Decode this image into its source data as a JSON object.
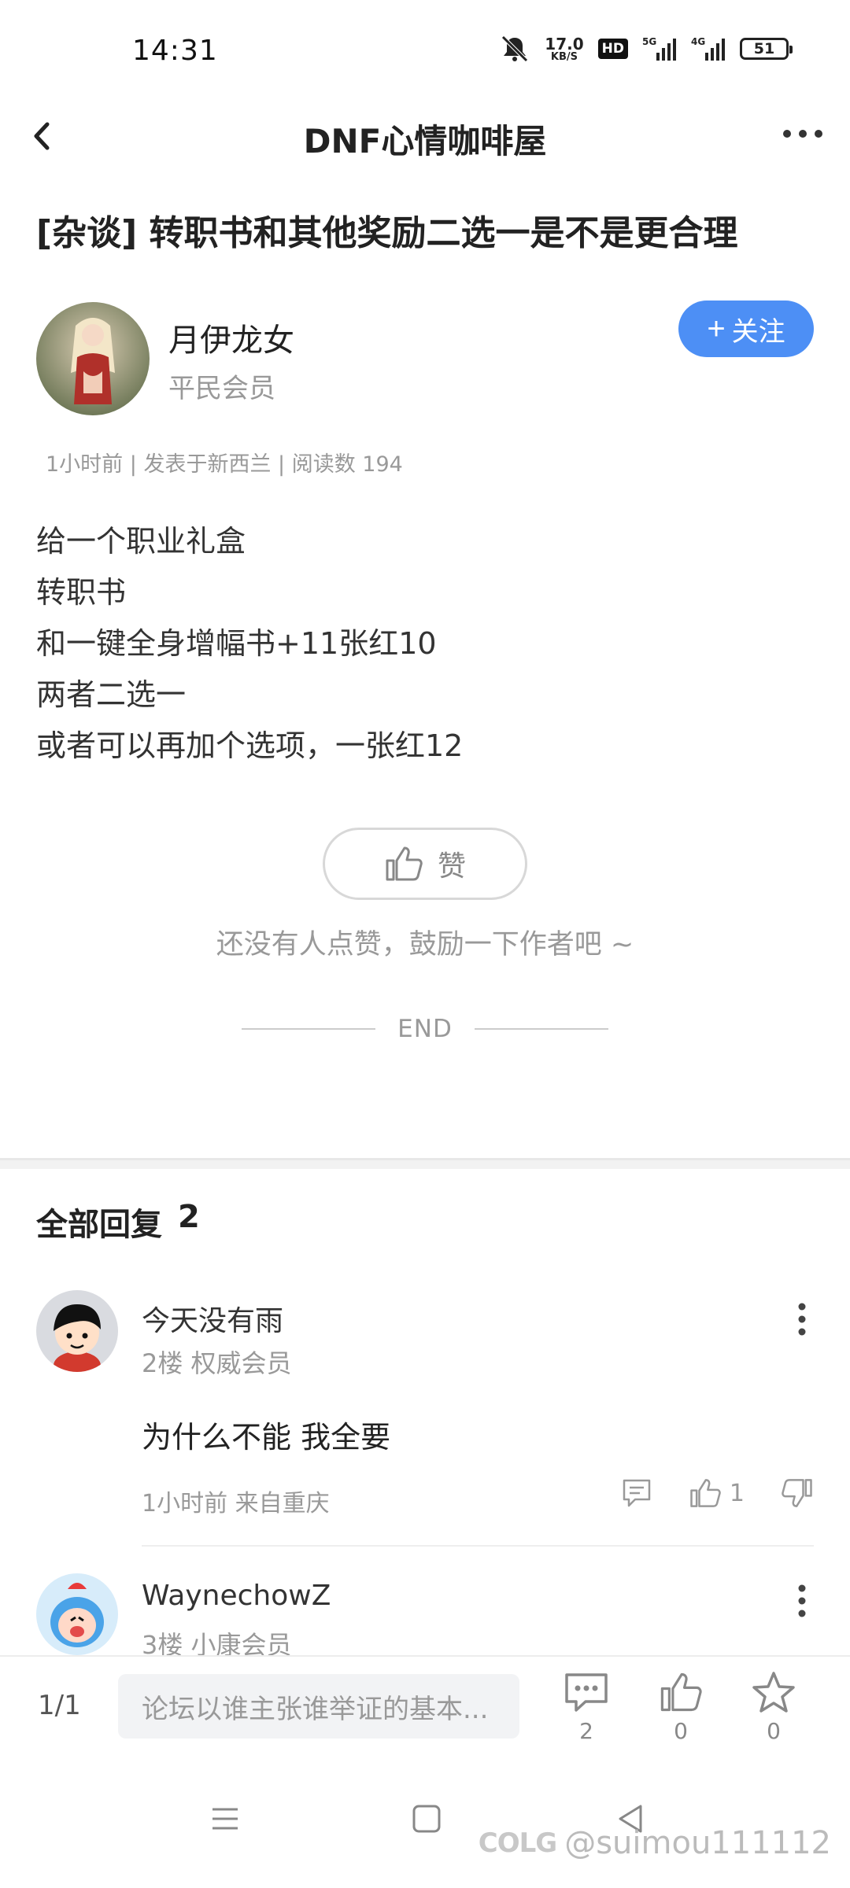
{
  "status_bar": {
    "time": "14:31",
    "net_speed_value": "17.0",
    "net_speed_unit": "KB/S",
    "hd_badge": "HD",
    "signal_5g": "5G",
    "signal_4g": "4G",
    "battery": "51"
  },
  "nav": {
    "title": "DNF心情咖啡屋"
  },
  "post": {
    "title": "[杂谈] 转职书和其他奖励二选一是不是更合理",
    "author": {
      "name": "月伊龙女",
      "level": "平民会员"
    },
    "follow_label": "关注",
    "follow_plus": "+",
    "meta": "1小时前 | 发表于新西兰 | 阅读数 194",
    "body_lines": [
      "给一个职业礼盒",
      "转职书",
      "和一键全身增幅书+11张红10",
      "两者二选一",
      "或者可以再加个选项，一张红12"
    ],
    "like_label": "赞",
    "like_hint": "还没有人点赞，鼓励一下作者吧 ~",
    "end_label": "END"
  },
  "replies": {
    "header_label": "全部回复",
    "count": "2",
    "items": [
      {
        "name": "今天没有雨",
        "meta": "2楼 权威会员",
        "text": "为什么不能 我全要",
        "time": "1小时前 来自重庆",
        "likes": "1"
      },
      {
        "name": "WaynechowZ",
        "meta": "3楼 小康会员"
      }
    ]
  },
  "bottom_bar": {
    "page": "1/1",
    "input_placeholder": "论坛以谁主张谁举证的基本...",
    "comment_count": "2",
    "like_count": "0",
    "star_count": "0"
  },
  "watermark": {
    "logo": "COLG",
    "handle": "@suimou111112"
  },
  "colors": {
    "accent": "#4d8ff5",
    "muted_text": "#999999",
    "divider": "#f2f2f2"
  }
}
